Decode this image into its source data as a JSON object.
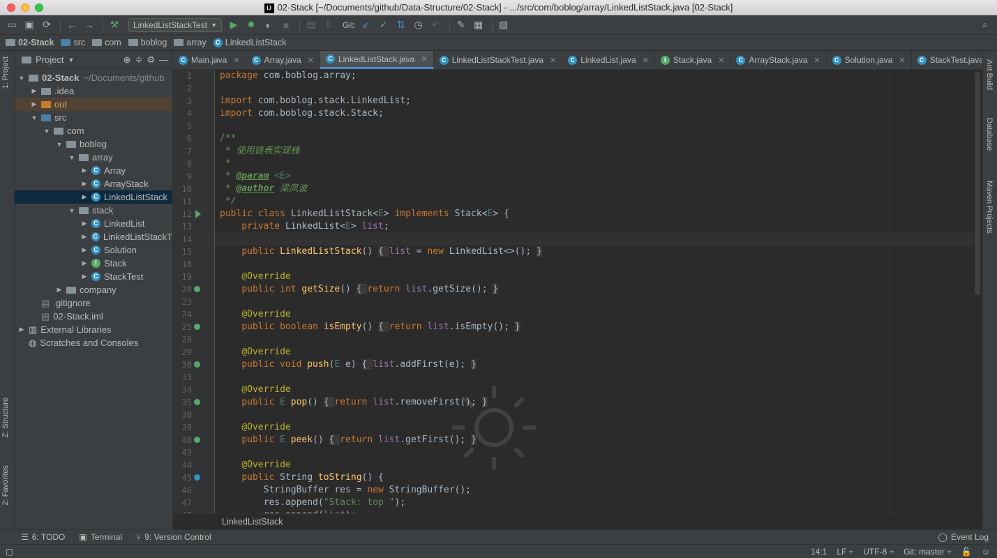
{
  "window": {
    "title": "02-Stack [~/Documents/github/Data-Structure/02-Stack] - .../src/com/boblog/array/LinkedListStack.java [02-Stack]"
  },
  "toolbar": {
    "run_config": "LinkedListStackTest",
    "git_label": "Git:"
  },
  "navbar": [
    "02-Stack",
    "src",
    "com",
    "boblog",
    "array",
    "LinkedListStack"
  ],
  "left_strip": {
    "project": "1: Project",
    "structure": "Z: Structure",
    "favorites": "2: Favorites"
  },
  "right_strip": {
    "ant": "Ant Build",
    "database": "Database",
    "maven": "Maven Projects"
  },
  "project_panel": {
    "title": "Project",
    "tree": [
      {
        "label": "02-Stack",
        "suffix": "~/Documents/github",
        "depth": 0,
        "arrow": "down",
        "icon": "folder",
        "bold": true
      },
      {
        "label": ".idea",
        "depth": 1,
        "arrow": "right",
        "icon": "folder"
      },
      {
        "label": "out",
        "depth": 1,
        "arrow": "right",
        "icon": "folder-orange",
        "hl": true
      },
      {
        "label": "src",
        "depth": 1,
        "arrow": "down",
        "icon": "folder-blue"
      },
      {
        "label": "com",
        "depth": 2,
        "arrow": "down",
        "icon": "folder"
      },
      {
        "label": "boblog",
        "depth": 3,
        "arrow": "down",
        "icon": "folder"
      },
      {
        "label": "array",
        "depth": 4,
        "arrow": "down",
        "icon": "folder"
      },
      {
        "label": "Array",
        "depth": 5,
        "arrow": "right",
        "icon": "class"
      },
      {
        "label": "ArrayStack",
        "depth": 5,
        "arrow": "right",
        "icon": "class"
      },
      {
        "label": "LinkedListStack",
        "depth": 5,
        "arrow": "right",
        "icon": "class",
        "sel": true
      },
      {
        "label": "stack",
        "depth": 4,
        "arrow": "down",
        "icon": "folder"
      },
      {
        "label": "LinkedList",
        "depth": 5,
        "arrow": "right",
        "icon": "class"
      },
      {
        "label": "LinkedListStackT",
        "depth": 5,
        "arrow": "right",
        "icon": "class"
      },
      {
        "label": "Solution",
        "depth": 5,
        "arrow": "right",
        "icon": "class"
      },
      {
        "label": "Stack",
        "depth": 5,
        "arrow": "right",
        "icon": "interface"
      },
      {
        "label": "StackTest",
        "depth": 5,
        "arrow": "right",
        "icon": "class"
      },
      {
        "label": "company",
        "depth": 3,
        "arrow": "right",
        "icon": "folder"
      },
      {
        "label": ".gitignore",
        "depth": 1,
        "arrow": "",
        "icon": "file"
      },
      {
        "label": "02-Stack.iml",
        "depth": 1,
        "arrow": "",
        "icon": "file"
      },
      {
        "label": "External Libraries",
        "depth": 0,
        "arrow": "right",
        "icon": "lib"
      },
      {
        "label": "Scratches and Consoles",
        "depth": 0,
        "arrow": "",
        "icon": "scratch"
      }
    ]
  },
  "tabs": [
    {
      "label": "Main.java",
      "icon": "class"
    },
    {
      "label": "Array.java",
      "icon": "class"
    },
    {
      "label": "LinkedListStack.java",
      "icon": "class",
      "active": true
    },
    {
      "label": "LinkedListStackTest.java",
      "icon": "class"
    },
    {
      "label": "LinkedList.java",
      "icon": "class"
    },
    {
      "label": "Stack.java",
      "icon": "interface"
    },
    {
      "label": "ArrayStack.java",
      "icon": "class"
    },
    {
      "label": "Solution.java",
      "icon": "class"
    },
    {
      "label": "StackTest.java",
      "icon": "class"
    }
  ],
  "code_lines": [
    {
      "n": "1",
      "html": "<span class=\"kw\">package </span>com.boblog.array;"
    },
    {
      "n": "2",
      "html": ""
    },
    {
      "n": "3",
      "html": "<span class=\"kw\">import </span>com.boblog.stack.LinkedList;"
    },
    {
      "n": "4",
      "html": "<span class=\"kw\">import </span>com.boblog.stack.Stack;"
    },
    {
      "n": "5",
      "html": ""
    },
    {
      "n": "6",
      "html": "<span class=\"cmt\">/**</span>"
    },
    {
      "n": "7",
      "html": "<span class=\"cmt\"> * 使用链表实现栈</span>"
    },
    {
      "n": "8",
      "html": "<span class=\"cmt\"> *</span>"
    },
    {
      "n": "9",
      "html": "<span class=\"cmt\"> * </span><span class=\"tag\">@param</span><span class=\"cmt\"> </span><span class=\"gen\">&lt;E&gt;</span>"
    },
    {
      "n": "10",
      "html": "<span class=\"cmt\"> * </span><span class=\"tag\">@author</span><span class=\"cmt\"> 梁凤波</span>"
    },
    {
      "n": "11",
      "html": "<span class=\"cmt\"> */</span>"
    },
    {
      "n": "12",
      "html": "<span class=\"kw\">public class </span>LinkedListStack&lt;<span class=\"gen\">E</span>&gt; <span class=\"kw\">implements </span>Stack&lt;<span class=\"gen\">E</span>&gt; {",
      "mark": "run"
    },
    {
      "n": "13",
      "html": "    <span class=\"kw\">private </span>LinkedList&lt;<span class=\"gen\">E</span>&gt; <span class=\"fld\">list</span>;"
    },
    {
      "n": "14",
      "html": "",
      "cur": true
    },
    {
      "n": "15",
      "html": "    <span class=\"kw\">public </span><span class=\"fn\">LinkedListStack</span>() <span class=\"fold\">{ </span><span class=\"fld\">list </span>= <span class=\"kw\">new </span>LinkedList&lt;&gt;(); <span class=\"fold\">}</span>"
    },
    {
      "n": "18",
      "html": ""
    },
    {
      "n": "19",
      "html": "    <span class=\"ann\">@Override</span>"
    },
    {
      "n": "20",
      "html": "    <span class=\"kw\">public int </span><span class=\"fn\">getSize</span>() <span class=\"fold\">{ </span><span class=\"kw\">return </span><span class=\"fld\">list</span>.getSize(); <span class=\"fold\">}</span>",
      "mark": "impl"
    },
    {
      "n": "23",
      "html": ""
    },
    {
      "n": "24",
      "html": "    <span class=\"ann\">@Override</span>"
    },
    {
      "n": "25",
      "html": "    <span class=\"kw\">public boolean </span><span class=\"fn\">isEmpty</span>() <span class=\"fold\">{ </span><span class=\"kw\">return </span><span class=\"fld\">list</span>.isEmpty(); <span class=\"fold\">}</span>",
      "mark": "impl"
    },
    {
      "n": "28",
      "html": ""
    },
    {
      "n": "29",
      "html": "    <span class=\"ann\">@Override</span>"
    },
    {
      "n": "30",
      "html": "    <span class=\"kw\">public void </span><span class=\"fn\">push</span>(<span class=\"gen\">E </span>e) <span class=\"fold\">{ </span><span class=\"fld\">list</span>.addFirst(e); <span class=\"fold\">}</span>",
      "mark": "impl"
    },
    {
      "n": "33",
      "html": ""
    },
    {
      "n": "34",
      "html": "    <span class=\"ann\">@Override</span>"
    },
    {
      "n": "35",
      "html": "    <span class=\"kw\">public </span><span class=\"gen\">E </span><span class=\"fn\">pop</span>() <span class=\"fold\">{ </span><span class=\"kw\">return </span><span class=\"fld\">list</span>.removeFirst(); <span class=\"fold\">}</span>",
      "mark": "impl"
    },
    {
      "n": "38",
      "html": ""
    },
    {
      "n": "39",
      "html": "    <span class=\"ann\">@Override</span>"
    },
    {
      "n": "40",
      "html": "    <span class=\"kw\">public </span><span class=\"gen\">E </span><span class=\"fn\">peek</span>() <span class=\"fold\">{ </span><span class=\"kw\">return </span><span class=\"fld\">list</span>.getFirst(); <span class=\"fold\">}</span>",
      "mark": "impl"
    },
    {
      "n": "43",
      "html": ""
    },
    {
      "n": "44",
      "html": "    <span class=\"ann\">@Override</span>"
    },
    {
      "n": "45",
      "html": "    <span class=\"kw\">public </span>String <span class=\"fn\">toString</span>() {",
      "mark": "over"
    },
    {
      "n": "46",
      "html": "        StringBuffer res = <span class=\"kw\">new </span>StringBuffer();"
    },
    {
      "n": "47",
      "html": "        res.append(<span class=\"str\">\"Stack: top \"</span>);"
    },
    {
      "n": "48",
      "html": "        res.append(<span class=\"fld\">list</span>);"
    }
  ],
  "editor_breadcrumb": "LinkedListStack",
  "bottom_tools": [
    {
      "label": "6: TODO",
      "icon": "todo-icon"
    },
    {
      "label": "Terminal",
      "icon": "terminal-icon"
    },
    {
      "label": "9: Version Control",
      "icon": "vcs-icon"
    }
  ],
  "event_log": "Event Log",
  "status": {
    "position": "14:1",
    "line_sep": "LF ÷",
    "encoding": "UTF-8 ÷",
    "git": "Git: master ÷"
  }
}
